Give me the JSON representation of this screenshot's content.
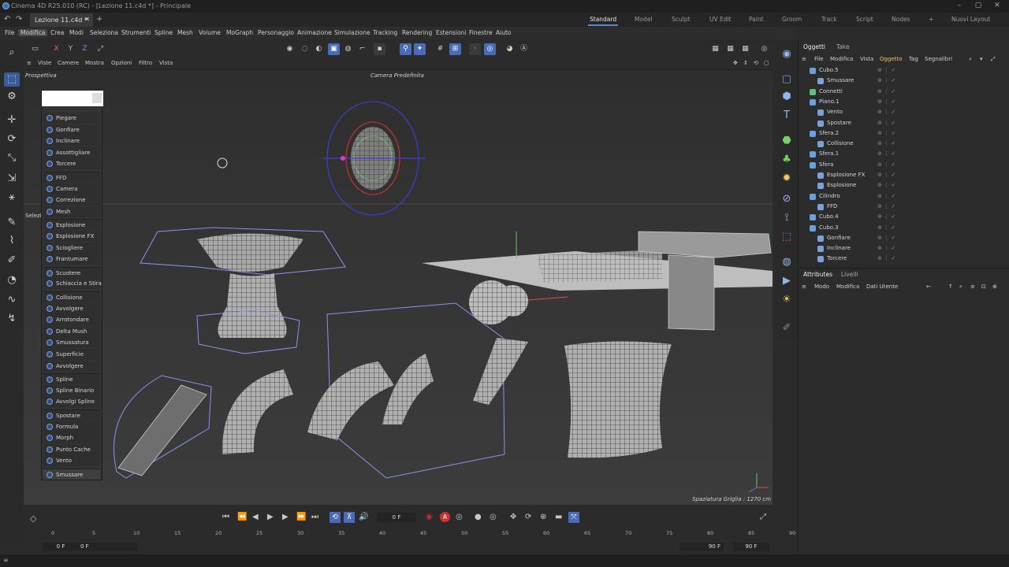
{
  "window": {
    "title": "Cinema 4D R25.010 (RC) - [Lezione 11.c4d *] - Principale"
  },
  "tabs": {
    "doc_tab": "Lezione 11.c4d *",
    "layouts": [
      "Standard",
      "Model",
      "Sculpt",
      "UV Edit",
      "Paint",
      "Groom",
      "Track",
      "Script",
      "Nodes"
    ],
    "active_layout": "Standard",
    "new_layout": "Nuovi Layout"
  },
  "menubar": [
    "File",
    "Modifica",
    "Crea",
    "Modi",
    "Seleziona",
    "Strumenti",
    "Spline",
    "Mesh",
    "Volume",
    "MoGraph",
    "Personaggio",
    "Animazione",
    "Simulazione",
    "Tracking",
    "Rendering",
    "Estensioni",
    "Finestre",
    "Aiuto"
  ],
  "menubar_active": "Modifica",
  "toolbar": {
    "axes": [
      "X",
      "Y",
      "Z"
    ]
  },
  "viewport_menu": [
    "Viste",
    "Camere",
    "Mostra",
    "Opzioni",
    "Filtro",
    "Vista"
  ],
  "viewport": {
    "label": "Prospettiva",
    "camera": "Camera Predefinita",
    "side_label": "Selezio",
    "grid_spacing": "Spaziatura Griglia : 1270 cm"
  },
  "deformer_menu": {
    "items": [
      "Piegare",
      "Gonfiare",
      "Inclinare",
      "Assottigliare",
      "Torcere",
      "FFD",
      "Camera",
      "Correzione",
      "Mesh",
      "Esplosione",
      "Esplosione FX",
      "Sciogliere",
      "Frantumare",
      "Scuotere",
      "Schiaccia e Stira",
      "Collisione",
      "Avvolgere",
      "Arrotondare",
      "Delta Mush",
      "Smussatura",
      "Superficie",
      "Avvolgere",
      "Spline",
      "Spline Binario",
      "Avvolgi Spline",
      "Spostare",
      "Formula",
      "Morph",
      "Punto Cache",
      "Vento",
      "Smussare"
    ],
    "separators_before": [
      5,
      9,
      13,
      15,
      22,
      25,
      30
    ],
    "highlighted": "Smussare"
  },
  "timeline": {
    "current_frame": "0 F",
    "ticks": [
      "0",
      "5",
      "10",
      "15",
      "20",
      "25",
      "30",
      "35",
      "40",
      "45",
      "50",
      "55",
      "60",
      "65",
      "70",
      "75",
      "80",
      "85",
      "90"
    ],
    "start_field": "0 F",
    "start_field2": "0 F",
    "end_field": "90 F",
    "end_field2": "90 F"
  },
  "object_panel": {
    "tabs": [
      "Oggetti",
      "Take"
    ],
    "active_tab": "Oggetti",
    "menu": [
      "File",
      "Modifica",
      "Vista",
      "Oggetto",
      "Tag",
      "Segnalibri"
    ],
    "menu_active": "Oggetto",
    "rows": [
      {
        "name": "Cubo.5",
        "indent": 0,
        "icon": "#6aa0e0"
      },
      {
        "name": "Smussare",
        "indent": 1,
        "icon": "#7ea0d8"
      },
      {
        "name": "Connetti",
        "indent": 0,
        "icon": "#5cc47a"
      },
      {
        "name": "Piano.1",
        "indent": 0,
        "icon": "#6aa0e0"
      },
      {
        "name": "Vento",
        "indent": 1,
        "icon": "#7ea0d8"
      },
      {
        "name": "Spostare",
        "indent": 1,
        "icon": "#7ea0d8"
      },
      {
        "name": "Sfera.2",
        "indent": 0,
        "icon": "#6aa0e0"
      },
      {
        "name": "Collisione",
        "indent": 1,
        "icon": "#7ea0d8"
      },
      {
        "name": "Sfera.1",
        "indent": 0,
        "icon": "#6aa0e0"
      },
      {
        "name": "Sfera",
        "indent": 0,
        "icon": "#6aa0e0"
      },
      {
        "name": "Esplosione FX",
        "indent": 1,
        "icon": "#7ea0d8"
      },
      {
        "name": "Esplosione",
        "indent": 1,
        "icon": "#7ea0d8"
      },
      {
        "name": "Cilindro",
        "indent": 0,
        "icon": "#6aa0e0"
      },
      {
        "name": "FFD",
        "indent": 1,
        "icon": "#7ea0d8"
      },
      {
        "name": "Cubo.4",
        "indent": 0,
        "icon": "#6aa0e0"
      },
      {
        "name": "Cubo.3",
        "indent": 0,
        "icon": "#6aa0e0"
      },
      {
        "name": "Gonfiare",
        "indent": 1,
        "icon": "#7ea0d8"
      },
      {
        "name": "Inclinare",
        "indent": 1,
        "icon": "#7ea0d8"
      },
      {
        "name": "Torcere",
        "indent": 1,
        "icon": "#7ea0d8"
      }
    ]
  },
  "attributes_panel": {
    "tabs": [
      "Attributes",
      "Livelli"
    ],
    "active_tab": "Attributes",
    "menu": [
      "Modo",
      "Modifica",
      "Dati Utente"
    ]
  },
  "colors": {
    "accent": "#4a6cb8",
    "wire": "#8f8ff0",
    "mesh": "#cfcfcf"
  }
}
